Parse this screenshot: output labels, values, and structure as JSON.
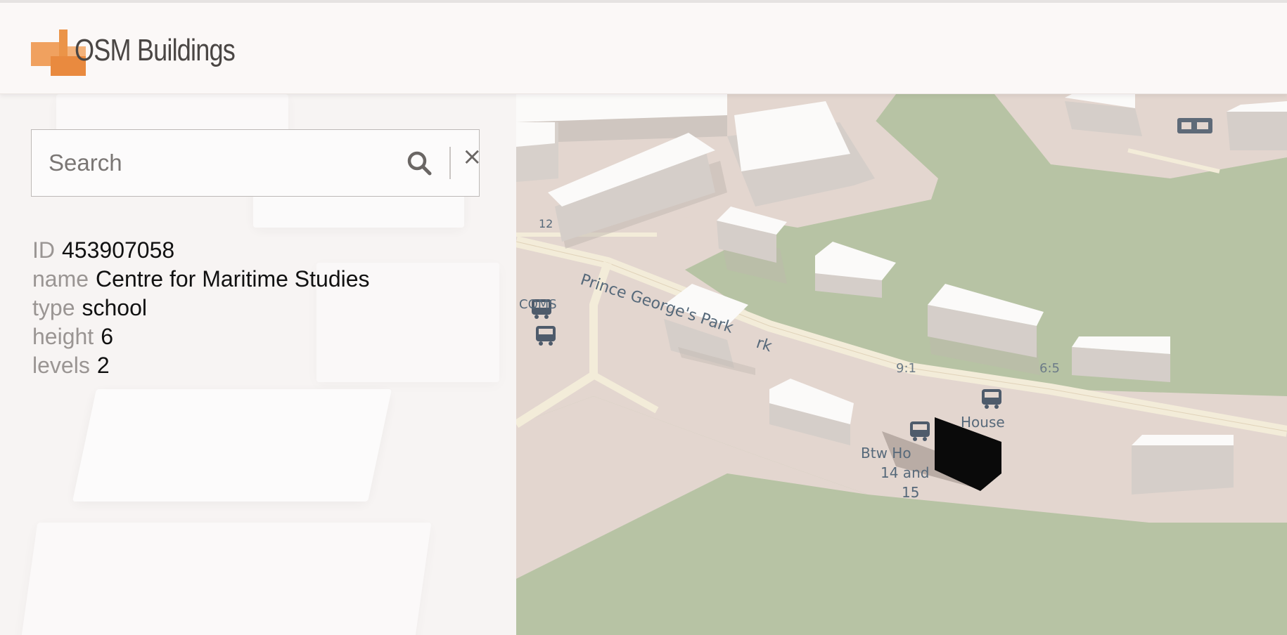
{
  "app": {
    "name": "OSM Buildings"
  },
  "search": {
    "placeholder": "Search",
    "value": ""
  },
  "icons": {
    "search": "magnifier-icon",
    "clear": "close-icon",
    "bus_stop": "bus-icon",
    "parking": "parking-icon"
  },
  "clear_glyph": "×",
  "building_info": [
    {
      "key": "ID",
      "value": "453907058"
    },
    {
      "key": "name",
      "value": "Centre for Maritime Studies"
    },
    {
      "key": "type",
      "value": "school"
    },
    {
      "key": "height",
      "value": "6"
    },
    {
      "key": "levels",
      "value": "2"
    }
  ],
  "map": {
    "street_label": "Prince George's Park",
    "street_label_continued": "rk",
    "labels": {
      "left": "COMS",
      "stop_a_time": "9:1",
      "stop_b_time": "6:5",
      "house": "House",
      "btw_line1": "Btw Ho",
      "btw_line2": "14 and",
      "btw_line3": "15",
      "num": "12"
    },
    "colors": {
      "ground": "#e3d6cf",
      "park": "#b7c3a4",
      "road": "#f3ecd9",
      "building_roof": "#fbfaf9",
      "building_side": "#d7d0cb",
      "selected_building": "#0a0a0a"
    }
  },
  "colors": {
    "brand_orange": "#e98a3f",
    "header_bg": "#fbf8f7",
    "sidebar_bg": "#f7f4f3",
    "key_text": "#9a9593"
  }
}
